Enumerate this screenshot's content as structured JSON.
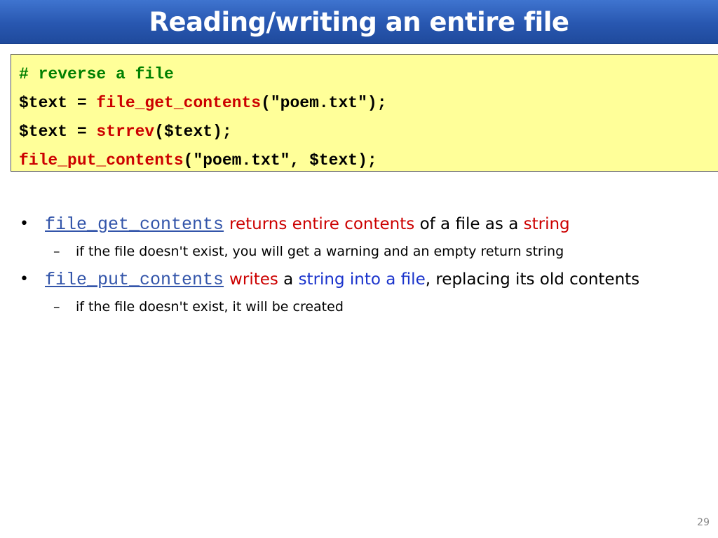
{
  "slide": {
    "title": "Reading/writing an entire file",
    "page_number": "29"
  },
  "code": {
    "line1": "# reverse a file",
    "line2_a": "$text = ",
    "line2_func": "file_get_contents",
    "line2_b": "(\"poem.txt\");",
    "line3_a": "$text = ",
    "line3_func": "strrev",
    "line3_b": "($text);",
    "line4_func": "file_put_contents",
    "line4_b": "(\"poem.txt\", $text);"
  },
  "bullets": [
    {
      "link": "file_get_contents",
      "p1": "returns entire contents",
      "p2": " of a file as a ",
      "p3": "string",
      "sub": "if the file doesn't exist, you will get a warning and an empty return string"
    },
    {
      "link": "file_put_contents",
      "p1": "writes",
      "p2": " a ",
      "p3": "string into a file",
      "p4": ", replacing its old contents",
      "sub": "if the file doesn't exist, it will be created"
    }
  ],
  "glyphs": {
    "bullet": "•",
    "dash": "–"
  },
  "colors": {
    "title_bar": "#2857b0",
    "code_background": "#ffff99",
    "comment": "#008000",
    "function": "#cc0000",
    "emphasis_red": "#cc0000",
    "emphasis_blue": "#1a33cc",
    "link": "#3355aa"
  }
}
